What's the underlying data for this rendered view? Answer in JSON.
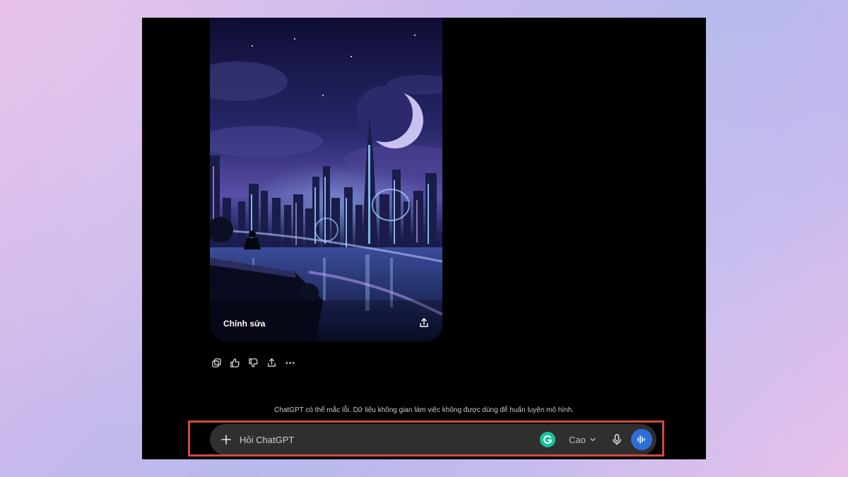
{
  "image_card": {
    "edit_label": "Chỉnh sửa"
  },
  "disclaimer": "ChatGPT có thể mắc lỗi. Dữ liệu không gian làm việc không được dùng để huấn luyện mô hình.",
  "composer": {
    "placeholder": "Hỏi ChatGPT",
    "model_label": "Cao"
  },
  "colors": {
    "voice_button": "#2e6fd6",
    "grammarly": "#15c39a",
    "highlight": "#cf4a41"
  },
  "icons": {
    "plus": "plus-icon",
    "grammarly": "grammarly-icon",
    "mic": "microphone-icon",
    "voice": "voice-waveform-icon",
    "copy": "copy-icon",
    "like": "thumbs-up-icon",
    "dislike": "thumbs-down-icon",
    "share": "share-icon",
    "more": "more-icon"
  }
}
